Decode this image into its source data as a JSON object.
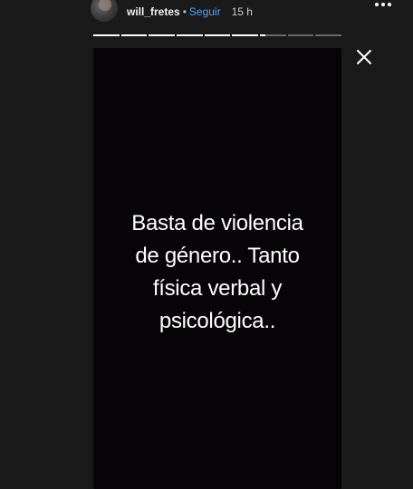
{
  "header": {
    "username": "will_fretes",
    "separator": "•",
    "follow_label": "Seguir",
    "timestamp": "15 h",
    "avatar_icon": "profile-avatar",
    "more_icon": "more-horizontal-icon"
  },
  "progress": {
    "segments": [
      1,
      1,
      1,
      1,
      1,
      1,
      0.2,
      0,
      0
    ],
    "active_color": "#ffffff",
    "inactive_color": "rgba(255,255,255,0.35)"
  },
  "close": {
    "icon": "close-icon"
  },
  "story": {
    "background": "#060406",
    "text": "Basta de violencia\nde género.. Tanto\nfísica verbal y\npsicológica.."
  }
}
